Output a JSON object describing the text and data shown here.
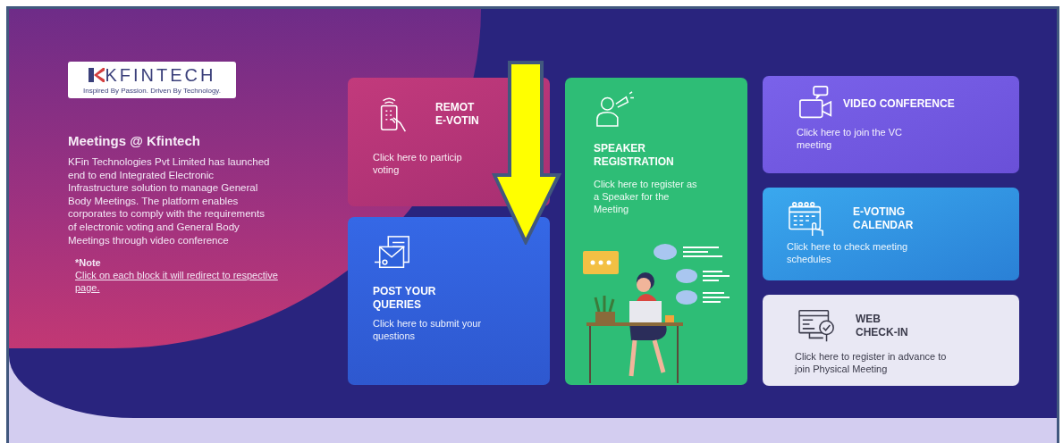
{
  "logo": {
    "brand": "KFINTECH",
    "tagline": "Inspired By Passion. Driven By Technology."
  },
  "intro": {
    "title": "Meetings @ Kfintech",
    "body": "KFin Technologies Pvt Limited has launched end to end Integrated Electronic Infrastructure solution to manage General Body Meetings. The platform enables corporates to comply with the requirements of electronic voting and General Body Meetings through video conference",
    "note_label": "*Note",
    "note_link": "Click on each block it will redirect to respective page."
  },
  "cards": [
    {
      "kind": "remote-voting",
      "title_lines": [
        "REMOT",
        "E-VOTIN"
      ],
      "text_lines": [
        "Click here to particip",
        "voting"
      ]
    },
    {
      "kind": "queries",
      "title_lines": [
        "POST YOUR",
        "QUERIES"
      ],
      "text_lines": [
        "Click here to submit your",
        "questions"
      ]
    },
    {
      "kind": "speaker",
      "title_lines": [
        "SPEAKER",
        "REGISTRATION"
      ],
      "text_lines": [
        "Click here to register as",
        "a Speaker for the",
        "Meeting"
      ]
    },
    {
      "kind": "video",
      "title_lines": [
        "VIDEO CONFERENCE"
      ],
      "text_lines": [
        "Click here to join the VC",
        "meeting"
      ]
    },
    {
      "kind": "calendar",
      "title_lines": [
        "E-VOTING",
        "CALENDAR"
      ],
      "text_lines": [
        "Click here to check meeting",
        "schedules"
      ]
    },
    {
      "kind": "checkin",
      "title_lines": [
        "WEB",
        "CHECK-IN"
      ],
      "text_lines": [
        "Click here to register in advance to",
        "join Physical Meeting"
      ]
    }
  ]
}
